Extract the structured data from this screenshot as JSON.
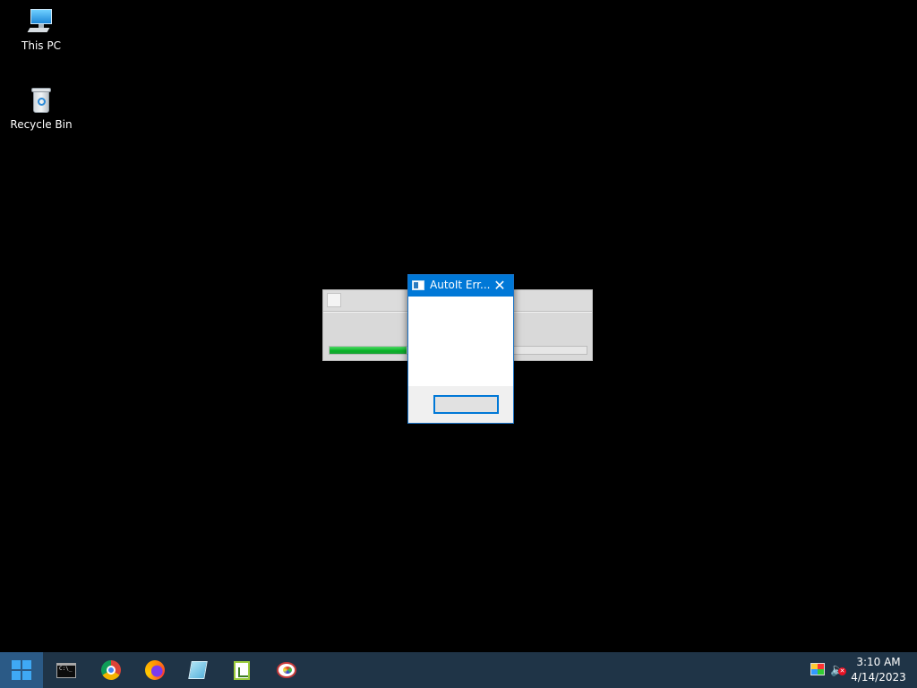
{
  "desktop": {
    "icons": [
      {
        "label": "This PC",
        "icon": "this-pc-icon"
      },
      {
        "label": "Recycle Bin",
        "icon": "recycle-bin-icon"
      }
    ]
  },
  "progress_window": {
    "progress_fraction": 0.3
  },
  "dialog": {
    "title": "AutoIt Err...",
    "close_glyph": "✕",
    "ok_label": ""
  },
  "taskbar": {
    "start_icon": "windows-logo-icon",
    "pinned": [
      {
        "name": "command-prompt-icon"
      },
      {
        "name": "chrome-icon"
      },
      {
        "name": "firefox-icon"
      },
      {
        "name": "notepad-icon"
      },
      {
        "name": "spreadsheet-icon"
      },
      {
        "name": "paint-icon"
      }
    ],
    "tray": {
      "time": "3:10 AM",
      "date": "4/14/2023",
      "volume_muted": true
    },
    "colors": {
      "taskbar_bg": "#1f3447",
      "accent": "#0078d7"
    }
  }
}
